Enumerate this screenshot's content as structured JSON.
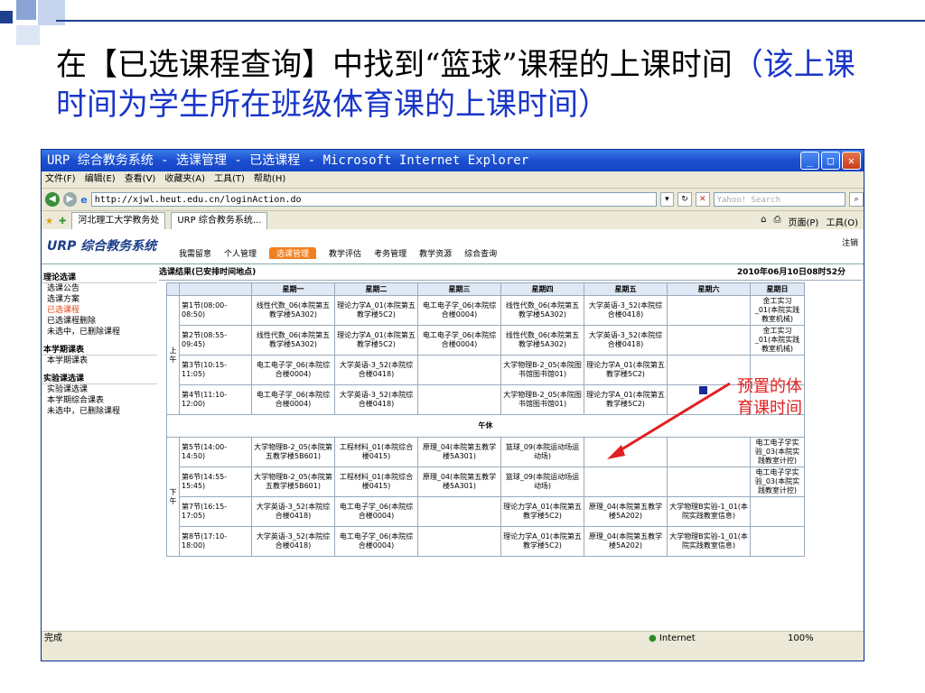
{
  "slide": {
    "title_black": "在【已选课程查询】中找到“篮球”课程的上课时间",
    "title_blue": "（该上课时间为学生所在班级体育课的上课时间）"
  },
  "window": {
    "title": "URP 综合教务系统 - 选课管理 - 已选课程 - Microsoft Internet Explorer",
    "menu": [
      "文件(F)",
      "编辑(E)",
      "查看(V)",
      "收藏夹(A)",
      "工具(T)",
      "帮助(H)"
    ],
    "url": "http://xjwl.heut.edu.cn/loginAction.do",
    "search_placeholder": "Yahoo! Search",
    "fav_tab1": "河北理工大学教务处",
    "fav_tab2": "URP 综合教务系统...",
    "fav_right": [
      "页面(P)",
      "工具(O)"
    ],
    "status": "完成",
    "zone": "Internet",
    "zoom": "100%"
  },
  "urp": {
    "logo": "URP 综合教务系统",
    "nav": [
      "我需留意",
      "个人管理",
      "选课管理",
      "教学评估",
      "考务管理",
      "教学资源",
      "综合查询"
    ],
    "logout": "注销",
    "sidebar": [
      {
        "section": "理论选课",
        "items": [
          "选课公告",
          "选课方案",
          "已选课程",
          "已选课程删除",
          "未选中，已删除课程"
        ]
      },
      {
        "section": "本学期课表",
        "items": [
          "本学期课表"
        ]
      },
      {
        "section": "实验课选课",
        "items": [
          "实验课选课",
          "本学期综合课表",
          "未选中，已删除课程"
        ]
      }
    ],
    "main_title": "选课结果(已安排时间地点)",
    "datetime": "2010年06月10日08时52分"
  },
  "schedule": {
    "days": [
      "星期一",
      "星期二",
      "星期三",
      "星期四",
      "星期五",
      "星期六",
      "星期日"
    ],
    "am_label": "上午",
    "pm_label": "下午",
    "noon_label": "午休",
    "am": [
      {
        "period": "第1节(08:00-08:50)",
        "cells": [
          "线性代数_06(本院第五教学楼5A302)",
          "理论力学A_01(本院第五教学楼5C2)",
          "电工电子学_06(本院综合楼0004)",
          "线性代数_06(本院第五教学楼5A302)",
          "大学英语-3_52(本院综合楼0418)",
          "",
          "金工实习_01(本院实践教室机械)"
        ]
      },
      {
        "period": "第2节(08:55-09:45)",
        "cells": [
          "线性代数_06(本院第五教学楼5A302)",
          "理论力学A_01(本院第五教学楼5C2)",
          "电工电子学_06(本院综合楼0004)",
          "线性代数_06(本院第五教学楼5A302)",
          "大学英语-3_52(本院综合楼0418)",
          "",
          "金工实习_01(本院实践教室机械)"
        ]
      },
      {
        "period": "第3节(10:15-11:05)",
        "cells": [
          "电工电子学_06(本院综合楼0004)",
          "大学英语-3_52(本院综合楼0418)",
          "",
          "大学物理B-2_05(本院图书馆图书馆01)",
          "理论力学A_01(本院第五教学楼5C2)",
          "",
          ""
        ]
      },
      {
        "period": "第4节(11:10-12:00)",
        "cells": [
          "电工电子学_06(本院综合楼0004)",
          "大学英语-3_52(本院综合楼0418)",
          "",
          "大学物理B-2_05(本院图书馆图书馆01)",
          "理论力学A_01(本院第五教学楼5C2)",
          "",
          ""
        ]
      }
    ],
    "pm": [
      {
        "period": "第5节(14:00-14:50)",
        "cells": [
          "大学物理B-2_05(本院第五教学楼5B601)",
          "工程材料_01(本院综合楼0415)",
          "原理_04(本院第五教学楼5A301)",
          "篮球_09(本院运动场运动场)",
          "",
          "",
          "电工电子学实验_03(本院实践教室计控)"
        ]
      },
      {
        "period": "第6节(14:55-15:45)",
        "cells": [
          "大学物理B-2_05(本院第五教学楼5B601)",
          "工程材料_01(本院综合楼0415)",
          "原理_04(本院第五教学楼5A301)",
          "篮球_09(本院运动场运动场)",
          "",
          "",
          "电工电子学实验_03(本院实践教室计控)"
        ]
      },
      {
        "period": "第7节(16:15-17:05)",
        "cells": [
          "大学英语-3_52(本院综合楼0418)",
          "电工电子学_06(本院综合楼0004)",
          "",
          "理论力学A_01(本院第五教学楼5C2)",
          "原理_04(本院第五教学楼5A202)",
          "大学物理B实验-1_01(本院实践教室信息)",
          ""
        ]
      },
      {
        "period": "第8节(17:10-18:00)",
        "cells": [
          "大学英语-3_52(本院综合楼0418)",
          "电工电子学_06(本院综合楼0004)",
          "",
          "理论力学A_01(本院第五教学楼5C2)",
          "原理_04(本院第五教学楼5A202)",
          "大学物理B实验-1_01(本院实践教室信息)",
          ""
        ]
      }
    ]
  },
  "annotation": {
    "text": "预置的体育课时间",
    "color": "#e02020"
  },
  "colors": {
    "title_blue": "#1a36c8",
    "ie_blue": "#1b4fd1",
    "urp_active": "#f08020"
  }
}
